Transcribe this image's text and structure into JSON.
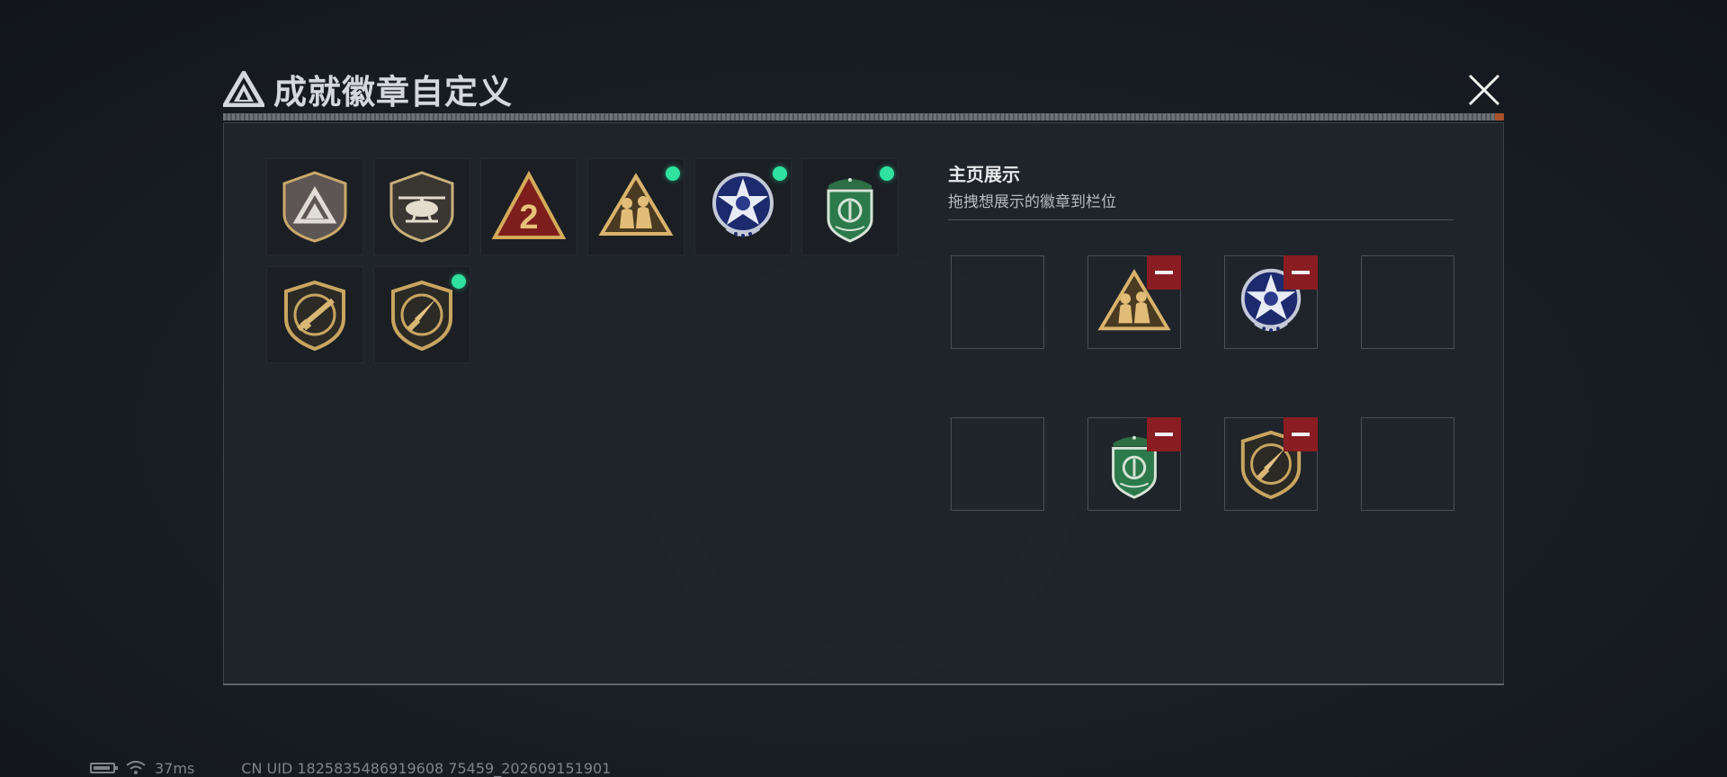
{
  "window": {
    "title": "成就徽章自定义",
    "logo_icon": "triangle-logo-icon",
    "close_icon": "close-icon"
  },
  "badges": [
    {
      "name": "gray-triangle-shield-badge",
      "has_new_dot": false
    },
    {
      "name": "helicopter-shield-badge",
      "has_new_dot": false
    },
    {
      "name": "red-triangle-number-2-badge",
      "has_new_dot": false
    },
    {
      "name": "soldiers-triangle-badge",
      "has_new_dot": true
    },
    {
      "name": "blue-star-medal-badge",
      "has_new_dot": true
    },
    {
      "name": "green-beret-shield-badge",
      "has_new_dot": true
    },
    {
      "name": "rifle-shield-badge",
      "has_new_dot": false
    },
    {
      "name": "knife-shield-badge",
      "has_new_dot": true
    }
  ],
  "display": {
    "title": "主页展示",
    "subtitle": "拖拽想展示的徽章到栏位",
    "slots": [
      {
        "badge": null
      },
      {
        "badge": "soldiers-triangle-badge",
        "removable": true
      },
      {
        "badge": "blue-star-medal-badge",
        "removable": true
      },
      {
        "badge": null
      },
      {
        "badge": null
      },
      {
        "badge": "green-beret-shield-badge",
        "removable": true
      },
      {
        "badge": "knife-shield-badge",
        "removable": true
      },
      {
        "badge": null
      }
    ]
  },
  "colors": {
    "new_dot": "#2fe2a0",
    "remove_button": "#8a1d22",
    "title_text": "#d4d8dc"
  },
  "status_bar": {
    "battery_icon": "battery-icon",
    "wifi_icon": "wifi-icon",
    "ping": "37ms",
    "uid": "CN UID 1825835486919608 75459_202609151901"
  }
}
